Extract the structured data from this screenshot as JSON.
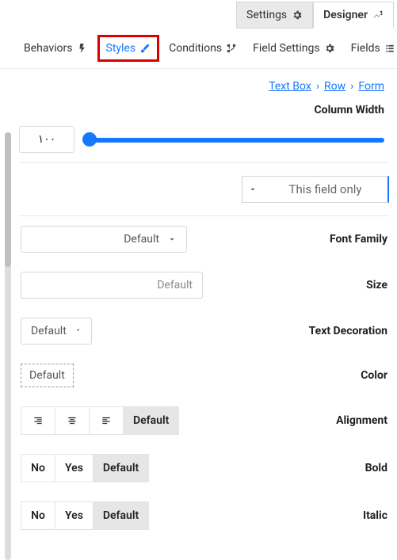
{
  "top_tabs": {
    "settings": "Settings",
    "designer": "Designer"
  },
  "sub_tabs": {
    "behaviors": "Behaviors",
    "styles": "Styles",
    "conditions": "Conditions",
    "field_settings": "Field Settings",
    "fields": "Fields"
  },
  "breadcrumbs": {
    "textbox": "Text Box",
    "row": "Row",
    "form": "Form"
  },
  "column_width": {
    "label": "Column Width",
    "value": "١٠٠"
  },
  "scope": {
    "selected": "This field only"
  },
  "font_family": {
    "label": "Font Family",
    "value": "Default"
  },
  "size": {
    "label": "Size",
    "placeholder": "Default"
  },
  "text_decoration": {
    "label": "Text Decoration",
    "value": "Default"
  },
  "color": {
    "label": "Color",
    "value": "Default"
  },
  "alignment": {
    "label": "Alignment",
    "default": "Default"
  },
  "bold": {
    "label": "Bold",
    "no": "No",
    "yes": "Yes",
    "default": "Default"
  },
  "italic": {
    "label": "Italic",
    "no": "No",
    "yes": "Yes",
    "default": "Default"
  }
}
